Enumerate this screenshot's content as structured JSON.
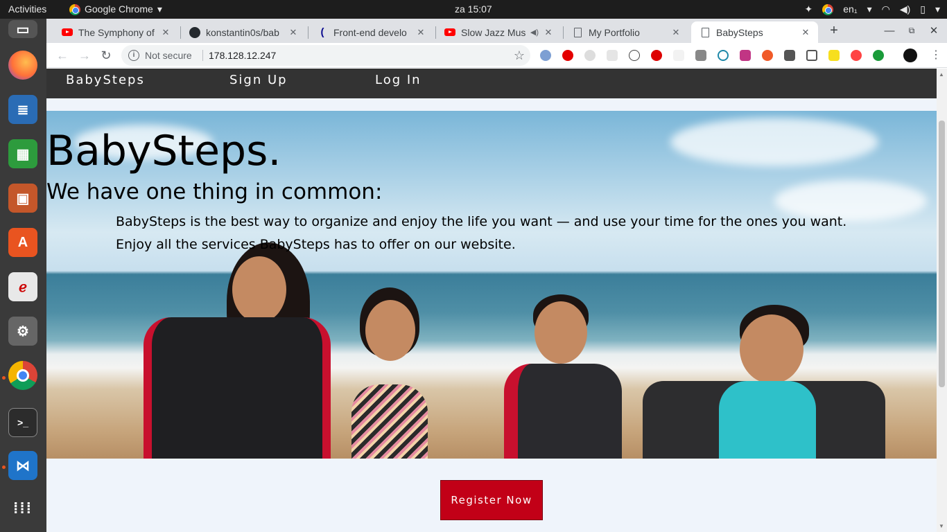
{
  "os": {
    "activities": "Activities",
    "app_menu": "Google Chrome",
    "clock": "za 15:07",
    "lang": "en₁"
  },
  "browser": {
    "tabs": [
      {
        "title": "The Symphony of",
        "icon": "youtube-icon"
      },
      {
        "title": "konstantin0s/bab",
        "icon": "github-icon"
      },
      {
        "title": "Front-end develo",
        "icon": "freecodecamp-icon"
      },
      {
        "title": "Slow Jazz Mus",
        "icon": "youtube-icon"
      },
      {
        "title": "My Portfolio",
        "icon": "page-icon"
      },
      {
        "title": "BabySteps",
        "icon": "page-icon"
      }
    ],
    "security": "Not secure",
    "url": "178.128.12.247"
  },
  "site": {
    "nav": {
      "brand": "BabySteps",
      "signup": "Sign Up",
      "login": "Log In"
    },
    "hero": {
      "title": "BabySteps.",
      "subtitle": "We have one thing in common:",
      "description": "BabySteps is the best way to organize and enjoy the life you want — and use your time for the ones you want. Enjoy all the services BabySteps has to offer on our website."
    },
    "cta": "Register Now"
  },
  "colors": {
    "nav_bg": "#333333",
    "cta_bg": "#c20017",
    "page_bg": "#eff4fb"
  }
}
